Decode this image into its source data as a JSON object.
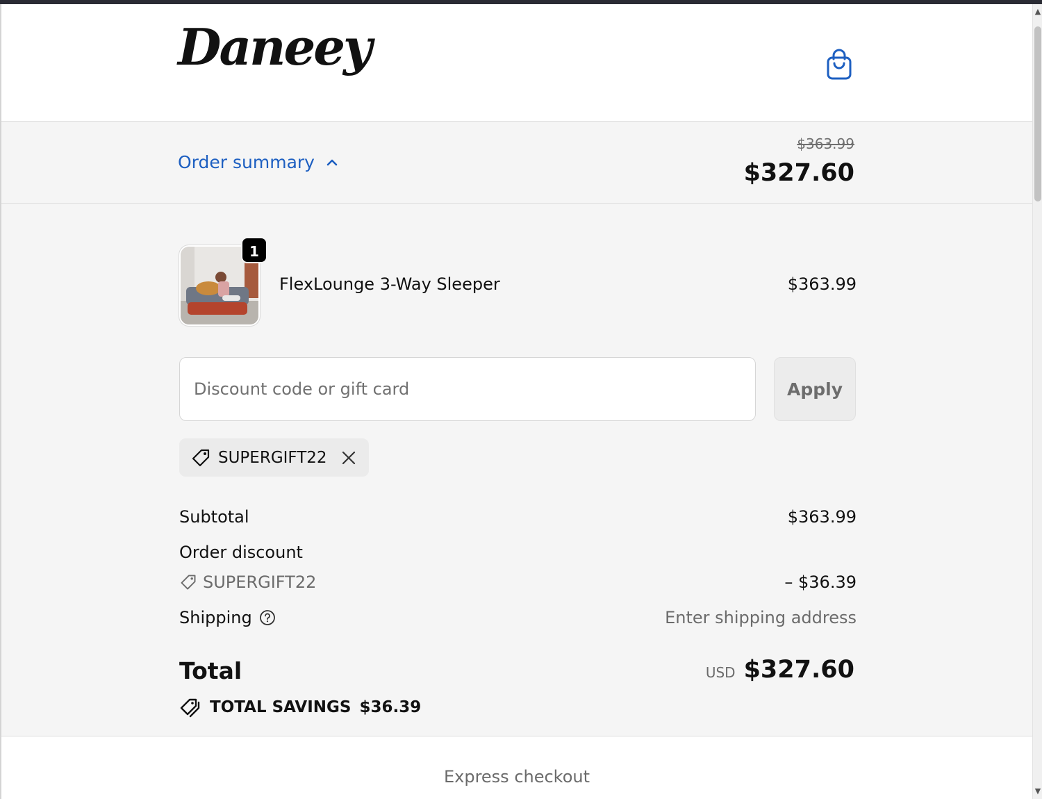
{
  "header": {
    "logo_text": "Daneey",
    "cart_icon": "shopping-bag-icon"
  },
  "summary_bar": {
    "toggle_label": "Order summary",
    "toggle_icon": "chevron-up-icon",
    "original_price": "$363.99",
    "current_price": "$327.60"
  },
  "item": {
    "name": "FlexLounge 3-Way Sleeper",
    "price": "$363.99",
    "quantity": "1"
  },
  "discount": {
    "placeholder": "Discount code or gift card",
    "value": "",
    "apply_label": "Apply"
  },
  "applied_code": {
    "code": "SUPERGIFT22",
    "icon": "tag-icon",
    "remove_icon": "close-icon"
  },
  "totals": {
    "subtotal_label": "Subtotal",
    "subtotal_value": "$363.99",
    "discount_label": "Order discount",
    "discount_code": "SUPERGIFT22",
    "discount_value": "– $36.39",
    "shipping_label": "Shipping",
    "shipping_value": "Enter shipping address",
    "total_label": "Total",
    "currency": "USD",
    "total_value": "$327.60",
    "savings_label": "TOTAL SAVINGS",
    "savings_value": "$36.39"
  },
  "express_checkout_label": "Express checkout",
  "colors": {
    "accent": "#1d5fc1",
    "background_muted": "#f5f5f5",
    "text_muted": "#6b6b6b"
  }
}
